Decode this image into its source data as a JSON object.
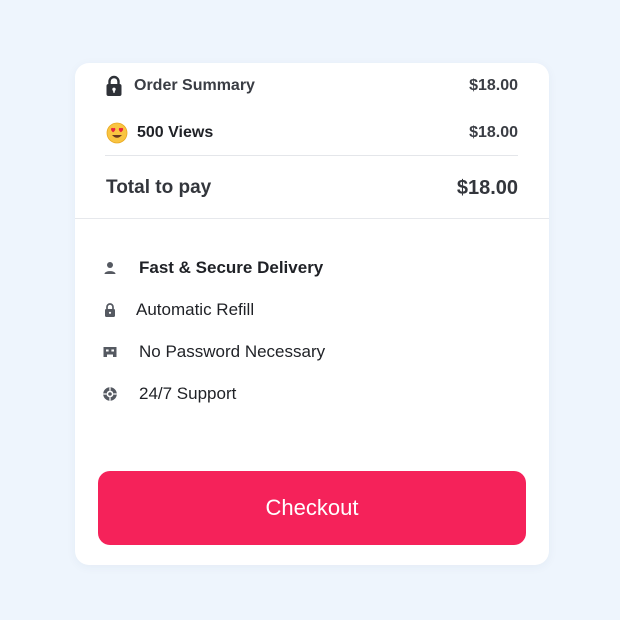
{
  "order": {
    "summary_label": "Order Summary",
    "summary_price": "$18.00",
    "item_label": "500 Views",
    "item_price": "$18.00",
    "total_label": "Total to pay",
    "total_value": "$18.00"
  },
  "features": [
    {
      "icon": "person-icon",
      "label": "Fast & Secure Delivery"
    },
    {
      "icon": "lock-icon",
      "label": "Automatic Refill"
    },
    {
      "icon": "mask-icon",
      "label": "No Password Necessary"
    },
    {
      "icon": "support-icon",
      "label": "24/7 Support"
    }
  ],
  "checkout": {
    "label": "Checkout",
    "color": "#f5225a"
  },
  "colors": {
    "background": "#eef5fd",
    "card": "#ffffff",
    "text": "#33363c"
  }
}
